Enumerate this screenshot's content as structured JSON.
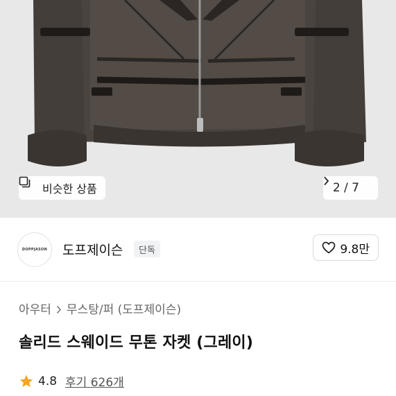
{
  "gallery": {
    "similar_label": "비슷한 상품",
    "similar_icon": "similar-items-icon",
    "pager": "2 / 7",
    "next_icon": "chevron-right-icon"
  },
  "brand": {
    "logo_text": "DOPPJASON",
    "name": "도프제이슨",
    "badge": "단독",
    "like_icon": "heart-icon",
    "like_count": "9.8만"
  },
  "breadcrumb": {
    "items": [
      "아우터",
      "무스탕/퍼 (도프제이슨)"
    ],
    "separator_icon": "chevron-right-icon"
  },
  "product": {
    "title": "솔리드 스웨이드 무톤 자켓 (그레이)",
    "rating": "4.8",
    "star_icon": "star-icon",
    "star_color": "#f5a623",
    "review_text": "후기 626개"
  }
}
